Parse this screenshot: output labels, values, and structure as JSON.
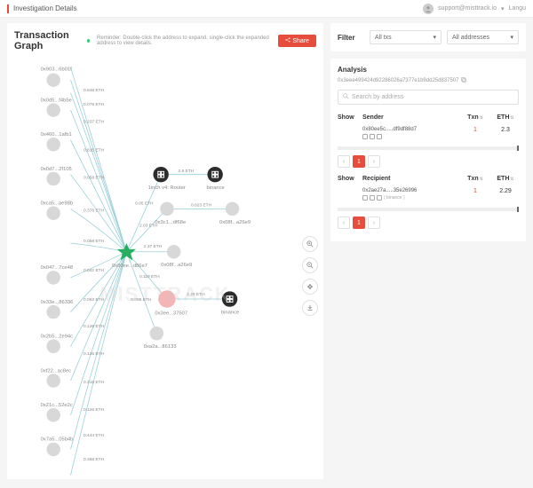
{
  "topbar": {
    "title": "Investigation Details",
    "email": "support@misttrack.io",
    "lang": "Langu"
  },
  "graph": {
    "title": "Transaction Graph",
    "reminder": "Reminder: Double-click the address to expand, single-click the expanded address to view details.",
    "share": "Share"
  },
  "nodes": {
    "left": [
      {
        "label": "0x903...6b01f"
      },
      {
        "label": "0x0d5...f4b5e"
      },
      {
        "label": "0x460...1afb1"
      },
      {
        "label": "0x0d7...2f105"
      },
      {
        "label": "0xca5...ae98b"
      },
      {
        "label": "0x047...7ce48"
      },
      {
        "label": "0x33e...86336"
      },
      {
        "label": "0x2b5...2e94c"
      },
      {
        "label": "0xf22...ac8ec"
      },
      {
        "label": "0x21c...52e2c"
      },
      {
        "label": "0x7a5...05b4b"
      }
    ],
    "center_star": "0x80ee...d86e7",
    "building1": "1inch v4: Router",
    "building2": "binance",
    "building3": "binance",
    "mid1": "0x3c1...df68e",
    "mid2": "0x08f...a26e9",
    "mid_right": "0x08f...a26e9",
    "pink": "0x3ee...37507",
    "bottom": "0xa2a...86133"
  },
  "edges": [
    "0.848 ETH",
    "0.079 ETH",
    "0.237 ETH",
    "0.815 ETH",
    "0.058 ETH",
    "0.378 ETH",
    "0.058 ETH",
    "0.042 ETH",
    "0.063 ETH",
    "0.126 ETH",
    "0.126 ETH",
    "0.416 ETH",
    "0.126 ETH",
    "0.444 ETH",
    "0.358 ETH",
    "0.05 ETH",
    "2.03 ETH",
    "2.37 ETH",
    "0.119 ETH",
    "0.095 ETH",
    "2.9 ETH",
    "0.023 ETH",
    "2.29 ETH"
  ],
  "filter": {
    "label": "Filter",
    "txs": "All txs",
    "addresses": "All addresses"
  },
  "analysis": {
    "title": "Analysis",
    "hash": "0x3eee499424d92286026a7377e1b9dd25d837507",
    "search_placeholder": "Search by address",
    "headers": {
      "show": "Show",
      "sender": "Sender",
      "recipient": "Recipient",
      "txn": "Txn",
      "eth": "ETH"
    },
    "sender_row": {
      "hash": "0x80ee5c.....df9df88d7",
      "txn": "1",
      "eth": "2.3"
    },
    "recipient_row": {
      "hash": "0x2ae27a.....35e26996",
      "tag": "( binance )",
      "txn": "1",
      "eth": "2.29"
    },
    "page": "1"
  },
  "watermark": "MISTTRACK"
}
